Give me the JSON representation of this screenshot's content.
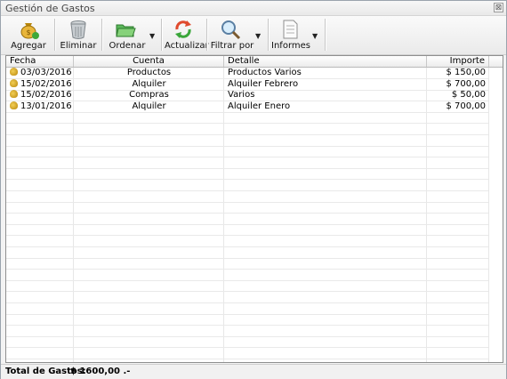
{
  "window": {
    "title": "Gestión de Gastos",
    "close_glyph": "⊠"
  },
  "toolbar": [
    {
      "label": "Agregar",
      "icon": "money-bag-icon"
    },
    {
      "label": "Eliminar",
      "icon": "trash-can-icon"
    },
    {
      "label": "Ordenar",
      "icon": "folder-icon",
      "dropdown": "▼"
    },
    {
      "label": "Actualizar",
      "icon": "refresh-icon"
    },
    {
      "label": "Filtrar por",
      "icon": "magnifier-icon",
      "dropdown": "▼"
    },
    {
      "label": "Informes",
      "icon": "document-icon",
      "dropdown": "▼"
    }
  ],
  "table": {
    "columns": [
      "Fecha",
      "Cuenta",
      "Detalle",
      "Importe"
    ],
    "rows": [
      {
        "fecha": "03/03/2016",
        "cuenta": "Productos",
        "detalle": "Productos Varios",
        "importe": "$ 150,00"
      },
      {
        "fecha": "15/02/2016",
        "cuenta": "Alquiler",
        "detalle": "Alquiler Febrero",
        "importe": "$ 700,00"
      },
      {
        "fecha": "15/02/2016",
        "cuenta": "Compras",
        "detalle": "Varios",
        "importe": "$ 50,00"
      },
      {
        "fecha": "13/01/2016",
        "cuenta": "Alquiler",
        "detalle": "Alquiler Enero",
        "importe": "$ 700,00"
      }
    ]
  },
  "footer": {
    "label": "Total de Gastos:",
    "value": "$ 1600,00 .-"
  }
}
